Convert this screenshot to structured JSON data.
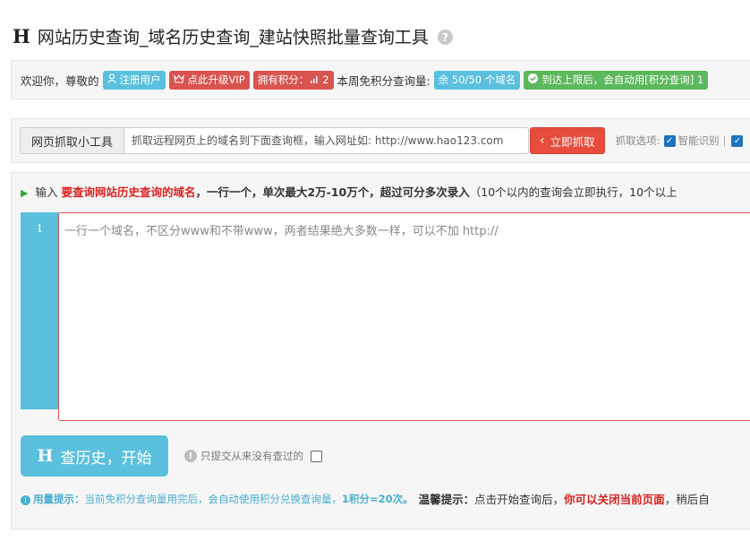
{
  "header": {
    "logo_letter": "H",
    "title": "网站历史查询_域名历史查询_建站快照批量查询工具",
    "help_icon": "question-circle-icon"
  },
  "welcome_bar": {
    "greeting": "欢迎你，尊敬的",
    "registered_user": "注册用户",
    "upgrade_vip": "点此升级VIP",
    "points_label": "拥有积分：",
    "points_value": "2",
    "weekly_quota_label": "本周免积分查询量:",
    "quota_value": "余 50/50 个域名",
    "auto_points": "到达上限后，会自动用[积分查询] 1",
    "colors": {
      "blue": "#5bc0de",
      "red": "#d9534f",
      "green": "#5cb85c"
    }
  },
  "grab_tool": {
    "label": "网页抓取小工具",
    "placeholder": "抓取远程网页上的域名到下面查询框，输入网址如: http://www.hao123.com",
    "button": "立即抓取",
    "options_label": "抓取选项:",
    "smart_option": "智能识别",
    "smart_checked": true,
    "separator": "|"
  },
  "instructions": {
    "prefix": "输入",
    "highlight": "要查询网站历史查询的域名",
    "middle": "，一行一个，单次最大2万-10万个，超过可分多次录入",
    "suffix": "（10个以内的查询会立即执行，10个以上"
  },
  "editor": {
    "line_number": "1",
    "placeholder": "一行一个域名，不区分www和不带www，两者结果绝大多数一样，可以不加 http://"
  },
  "submit": {
    "logo_letter": "H",
    "label": "查历史，开始",
    "only_new_label": "只提交从来没有查过的",
    "only_new_checked": false
  },
  "tips": {
    "usage_label": "用量提示：",
    "usage_text": "当前免积分查询量用完后，会自动使用积分兑换查询量，",
    "usage_rate": "1积分=20次。",
    "warm_label": "温馨提示：",
    "warm_text": "点击开始查询后，",
    "warm_red": "你可以关闭当前页面",
    "warm_tail": "，稍后自"
  }
}
